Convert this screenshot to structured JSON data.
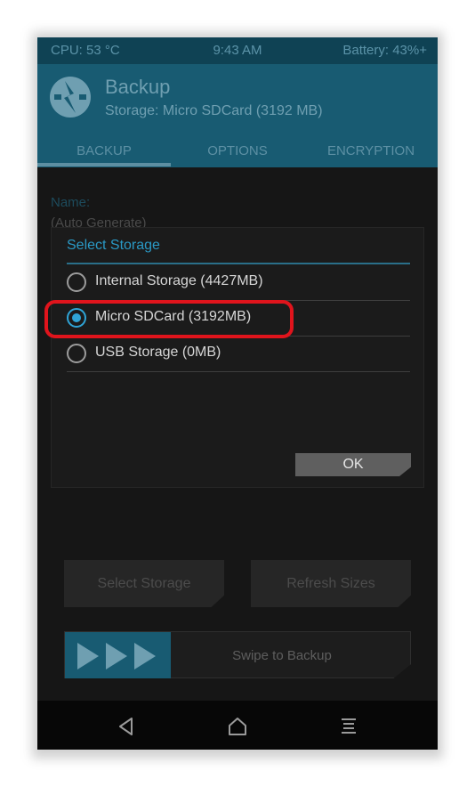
{
  "status_bar": {
    "cpu": "CPU: 53 °C",
    "time": "9:43 AM",
    "battery": "Battery: 43%+"
  },
  "header": {
    "title": "Backup",
    "subtitle": "Storage: Micro SDCard (3192 MB)",
    "logo_icon": "twrp-logo-icon",
    "tabs": [
      {
        "label": "BACKUP",
        "active": true
      },
      {
        "label": "OPTIONS",
        "active": false
      },
      {
        "label": "ENCRYPTION",
        "active": false
      }
    ]
  },
  "content": {
    "name_label": "Name:",
    "name_value": "(Auto Generate)"
  },
  "dialog": {
    "title": "Select Storage",
    "options": [
      {
        "label": "Internal Storage (4427MB)",
        "selected": false
      },
      {
        "label": "Micro SDCard (3192MB)",
        "selected": true
      },
      {
        "label": "USB Storage (0MB)",
        "selected": false
      }
    ],
    "ok_label": "OK"
  },
  "actions": {
    "select_storage": "Select Storage",
    "refresh_sizes": "Refresh Sizes"
  },
  "swipe": {
    "label": "Swipe to Backup",
    "icon": "triple-arrow-icon"
  },
  "nav": {
    "back_icon": "back-icon",
    "home_icon": "home-icon",
    "menu_icon": "menu-icon"
  },
  "colors": {
    "accent": "#2fa4d6",
    "header": "#185b72",
    "highlight": "#e0141c"
  }
}
